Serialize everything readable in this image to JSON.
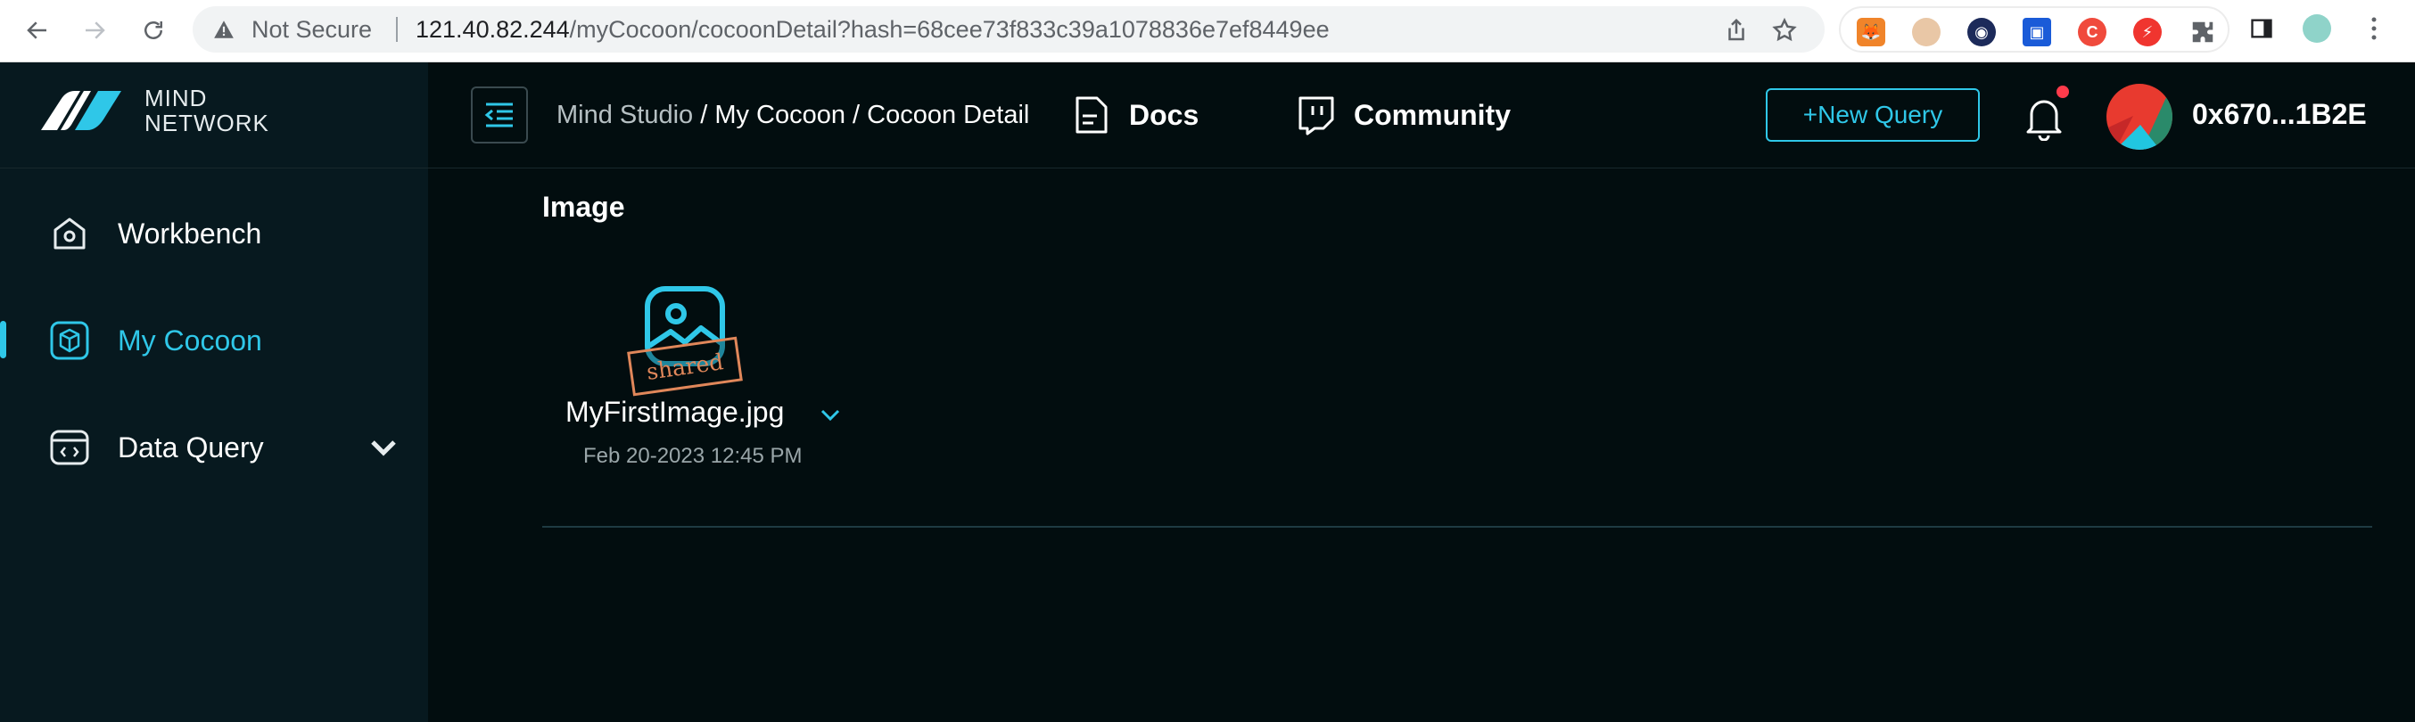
{
  "browser": {
    "security_label": "Not Secure",
    "url_host": "121.40.82.244",
    "url_path": "/myCocoon/cocoonDetail?hash=68cee73f833c39a1078836e7ef8449ee",
    "extensions": [
      "fox-extension-icon",
      "avatar-extension-icon",
      "eye-extension-icon",
      "shield-extension-icon",
      "red-c-extension-icon",
      "bolt-extension-icon",
      "puzzle-icon"
    ]
  },
  "brand": {
    "line1": "MIND",
    "line2": "NETWORK"
  },
  "sidebar": {
    "items": [
      {
        "label": "Workbench",
        "icon": "home-icon"
      },
      {
        "label": "My Cocoon",
        "icon": "cube-icon",
        "active": true
      },
      {
        "label": "Data Query",
        "icon": "code-window-icon",
        "expandable": true
      }
    ]
  },
  "header": {
    "breadcrumb": {
      "root": "Mind Studio",
      "sep": " / ",
      "level1": "My Cocoon",
      "level2": "Cocoon Detail"
    },
    "docs_label": "Docs",
    "community_label": "Community",
    "new_query_label": "+New Query",
    "wallet_address": "0x670...1B2E"
  },
  "main": {
    "section_title": "Image",
    "files": [
      {
        "name": "MyFirstImage.jpg",
        "date": "Feb 20-2023 12:45 PM",
        "stamp": "shared"
      }
    ]
  },
  "colors": {
    "accent": "#2fc7e8",
    "bg": "#020d0f",
    "sidebar": "#07191f",
    "stamp": "#e0875a"
  }
}
